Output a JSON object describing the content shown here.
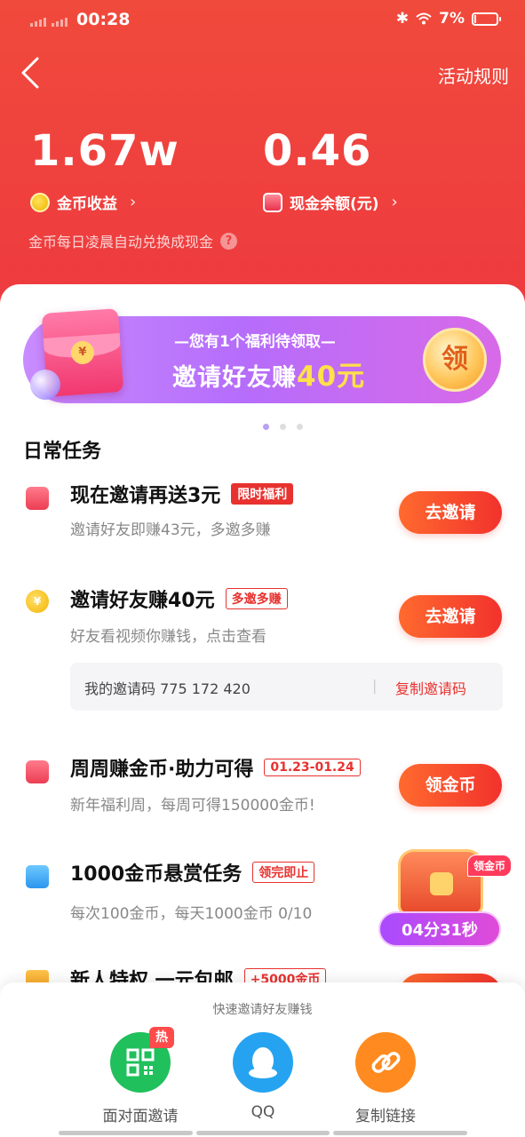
{
  "status": {
    "time": "00:28",
    "battery": "7%",
    "battery_level": 0.07
  },
  "header": {
    "rules_label": "活动规则"
  },
  "stats": {
    "coins_value": "1.67w",
    "coins_label": "金币收益",
    "cash_value": "0.46",
    "cash_label": "现金余额(元)",
    "hint": "金币每日凌晨自动兑换成现金"
  },
  "banner": {
    "subtitle": "—您有1个福利待领取—",
    "main_prefix": "邀请好友赚",
    "main_amount": "40元",
    "claim_label": "领",
    "envelope_symbol": "¥"
  },
  "section_title": "日常任务",
  "tasks": [
    {
      "title": "现在邀请再送3元",
      "tag": "限时福利",
      "desc": "邀请好友即赚43元，多邀多赚",
      "button": "去邀请",
      "icon": "red-envelope-icon"
    },
    {
      "title": "邀请好友赚40元",
      "tag": "多邀多赚",
      "desc": "好友看视频你赚钱，点击查看",
      "button": "去邀请",
      "icon": "coin-icon",
      "coin_symbol": "¥"
    },
    {
      "title": "周周赚金币·助力可得",
      "tag": "01.23-01.24",
      "desc": "新年福利周，每周可得150000金币!",
      "button": "领金币",
      "icon": "red-envelope-icon"
    },
    {
      "title": "1000金币悬赏任务",
      "tag": "领完即止",
      "desc": "每次100金币，每天1000金币 0/10",
      "icon": "tv-icon"
    },
    {
      "title": "新人特权 一元包邮",
      "tag": "+5000金币",
      "icon": "cart-icon"
    }
  ],
  "invite_code": {
    "label": "我的邀请码 775 172 420",
    "separator": "|",
    "copy_label": "复制邀请码"
  },
  "chest": {
    "badge": "领金币",
    "timer": "04分31秒"
  },
  "share": {
    "caption": "快速邀请好友赚钱",
    "items": [
      {
        "label": "面对面邀请",
        "badge": "热",
        "icon": "qr-code-icon"
      },
      {
        "label": "QQ",
        "icon": "qq-penguin-icon"
      },
      {
        "label": "复制链接",
        "icon": "link-icon"
      }
    ]
  }
}
